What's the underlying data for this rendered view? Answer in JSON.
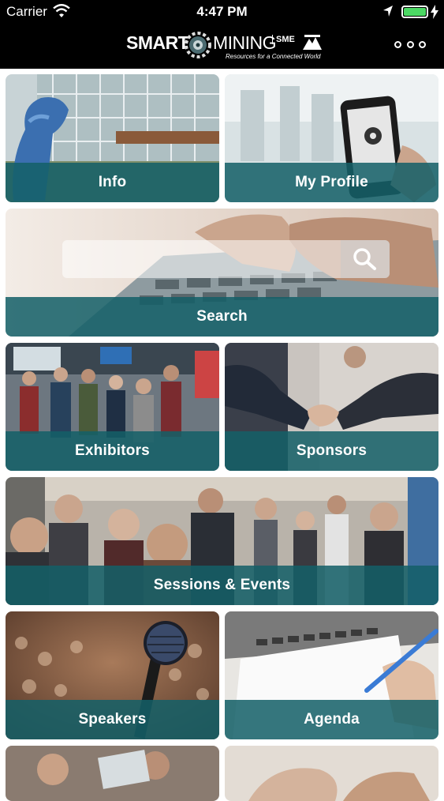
{
  "status_bar": {
    "carrier": "Carrier",
    "time": "4:47 PM",
    "battery_level": 1.0
  },
  "header": {
    "logo": {
      "word1": "SMART",
      "word2": "MINING",
      "tagline": "Resources for a Connected World",
      "org": "SME"
    },
    "menu_icon": "more-horizontal-icon"
  },
  "tiles": {
    "info": {
      "label": "Info"
    },
    "profile": {
      "label": "My Profile"
    },
    "search": {
      "label": "Search",
      "placeholder": ""
    },
    "exhibitors": {
      "label": "Exhibitors"
    },
    "sponsors": {
      "label": "Sponsors"
    },
    "sessions": {
      "label": "Sessions & Events"
    },
    "speakers": {
      "label": "Speakers"
    },
    "agenda": {
      "label": "Agenda"
    }
  },
  "colors": {
    "accent_band": "#146068",
    "header_bg": "#000000"
  }
}
